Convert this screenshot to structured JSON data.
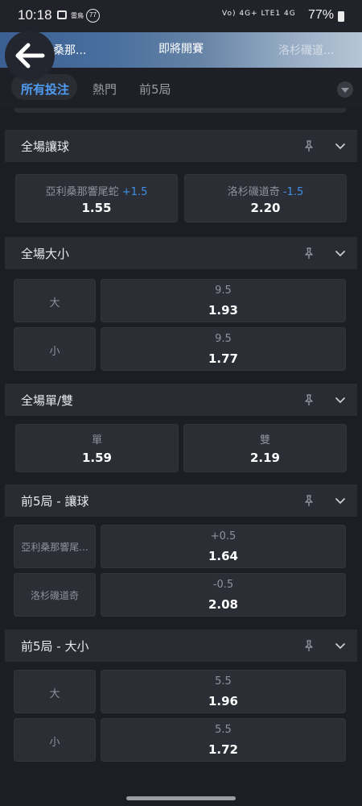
{
  "status": {
    "time": "10:18",
    "app_label": "雷鳥",
    "notif_count": "77",
    "sys": "Vo) 4G+ LTE1  4G",
    "battery": "77%"
  },
  "header": {
    "team_a": "亞利桑那...",
    "title": "即將開賽",
    "team_b": "洛杉磯道..."
  },
  "tabs": [
    "所有投注",
    "熱門",
    "前5局"
  ],
  "markets": {
    "handicap": {
      "title": "全場讓球",
      "home": {
        "team": "亞利桑那響尾蛇",
        "line": "+1.5",
        "odds": "1.55"
      },
      "away": {
        "team": "洛杉磯道奇",
        "line": "-1.5",
        "odds": "2.20"
      }
    },
    "total": {
      "title": "全場大小",
      "rows": [
        {
          "sel": "大",
          "line": "9.5",
          "odds": "1.93"
        },
        {
          "sel": "小",
          "line": "9.5",
          "odds": "1.77"
        }
      ]
    },
    "odd_even": {
      "title": "全場單/雙",
      "odd": {
        "label": "單",
        "odds": "1.59"
      },
      "even": {
        "label": "雙",
        "odds": "2.19"
      }
    },
    "f5_handicap": {
      "title": "前5局 - 讓球",
      "rows": [
        {
          "sel": "亞利桑那響尾...",
          "line": "+0.5",
          "odds": "1.64"
        },
        {
          "sel": "洛杉磯道奇",
          "line": "-0.5",
          "odds": "2.08"
        }
      ]
    },
    "f5_total": {
      "title": "前5局 - 大小",
      "rows": [
        {
          "sel": "大",
          "line": "5.5",
          "odds": "1.96"
        },
        {
          "sel": "小",
          "line": "5.5",
          "odds": "1.72"
        }
      ]
    }
  },
  "icons": {
    "back": "arrow-left-icon",
    "pin": "pin-icon",
    "chevron": "chevron-down-icon"
  },
  "colors": {
    "accent": "#4f9cf2",
    "background": "#1d1e24",
    "cell": "#2c2e36"
  }
}
